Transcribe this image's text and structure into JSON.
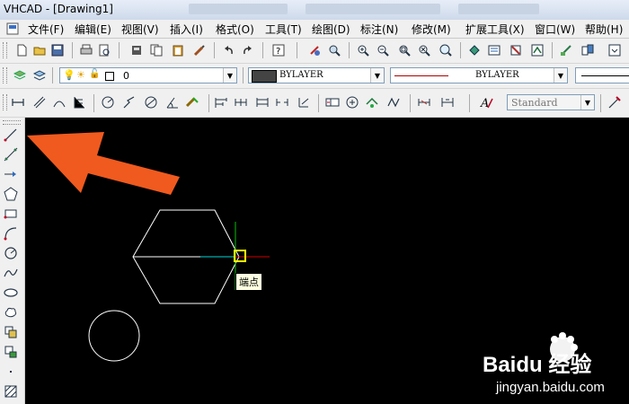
{
  "window": {
    "title": "VHCAD - [Drawing1]"
  },
  "menu": {
    "items": [
      {
        "label": "文件(F)"
      },
      {
        "label": "编辑(E)"
      },
      {
        "label": "视图(V)"
      },
      {
        "label": "插入(I)"
      },
      {
        "label": "格式(O)"
      },
      {
        "label": "工具(T)"
      },
      {
        "label": "绘图(D)"
      },
      {
        "label": "标注(N)"
      },
      {
        "label": "修改(M)"
      },
      {
        "label": "扩展工具(X)"
      },
      {
        "label": "窗口(W)"
      },
      {
        "label": "帮助(H)"
      }
    ]
  },
  "layer_bar": {
    "layer_value": "0",
    "color_value": "BYLAYER",
    "linetype_value": "BYLAYER"
  },
  "style_bar": {
    "text_style": "Standard"
  },
  "canvas": {
    "tooltip": "端点",
    "colors": {
      "hexagon": "#ffffff",
      "circle": "#ffffff",
      "arrow": "#f05a1e",
      "marker": "#ffff00"
    }
  },
  "watermark": {
    "brand": "Baidu 经验",
    "url": "jingyan.baidu.com"
  }
}
